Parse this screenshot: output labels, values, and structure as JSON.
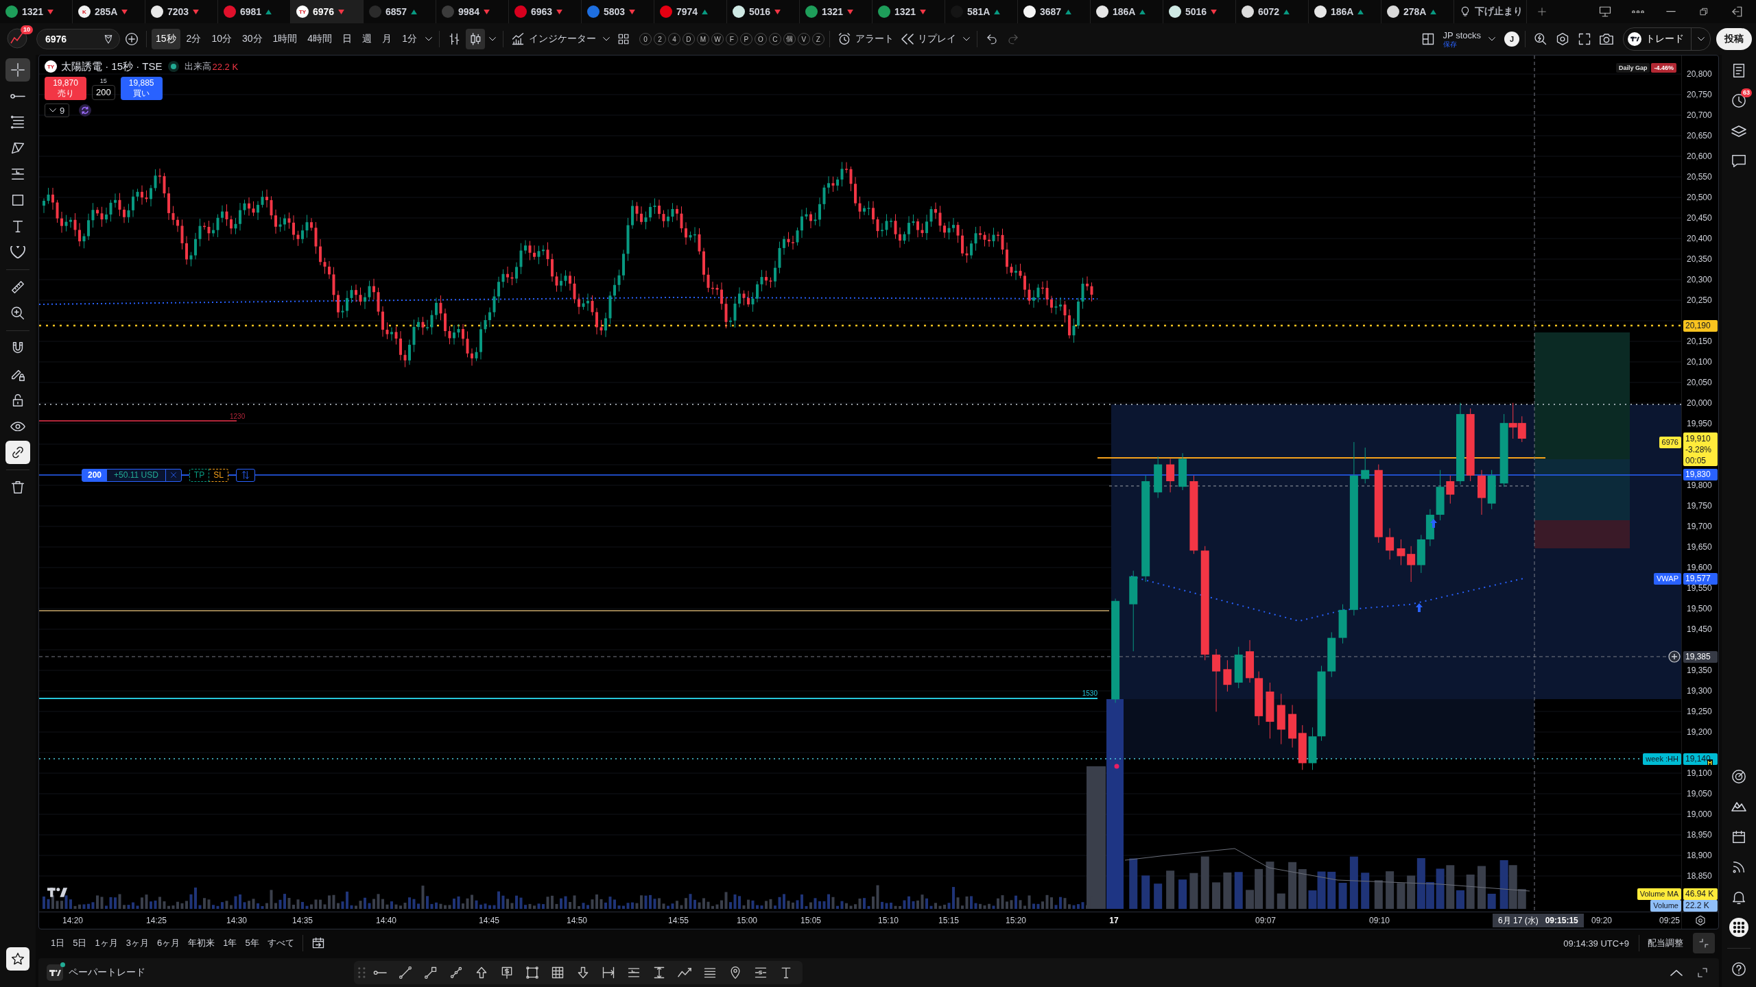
{
  "tabs": [
    {
      "kind": "symbol",
      "symbol": "1321",
      "rising": false,
      "color": "#1e9e5a",
      "selected": false
    },
    {
      "kind": "symbol",
      "symbol": "285A",
      "rising": false,
      "color": "#f2f2f2",
      "logo_text": "K",
      "selected": false
    },
    {
      "kind": "symbol",
      "symbol": "7203",
      "rising": false,
      "color": "#e8e8e8",
      "selected": false
    },
    {
      "kind": "symbol",
      "symbol": "6981",
      "rising": true,
      "color": "#e0102b",
      "selected": false
    },
    {
      "kind": "symbol",
      "symbol": "6976",
      "rising": false,
      "color": "#ffffff",
      "logo_text": "TY",
      "selected": true
    },
    {
      "kind": "symbol",
      "symbol": "6857",
      "rising": true,
      "color": "#2b2b2b",
      "selected": false
    },
    {
      "kind": "symbol",
      "symbol": "9984",
      "rising": false,
      "color": "#3c3c3c",
      "selected": false
    },
    {
      "kind": "symbol",
      "symbol": "6963",
      "rising": false,
      "color": "#d7001e",
      "selected": false
    },
    {
      "kind": "symbol",
      "symbol": "5803",
      "rising": false,
      "color": "#1e6fe0",
      "selected": false
    },
    {
      "kind": "symbol",
      "symbol": "7974",
      "rising": true,
      "color": "#e60012",
      "selected": false
    },
    {
      "kind": "symbol",
      "symbol": "5016",
      "rising": false,
      "color": "#cfe9e4",
      "selected": false
    },
    {
      "kind": "symbol",
      "symbol": "1321",
      "rising": false,
      "color": "#1e9e5a",
      "selected": false
    },
    {
      "kind": "symbol",
      "symbol": "1321",
      "rising": false,
      "color": "#1e9e5a",
      "selected": false
    },
    {
      "kind": "symbol",
      "symbol": "581A",
      "rising": true,
      "color": "#151515",
      "selected": false
    },
    {
      "kind": "symbol",
      "symbol": "3687",
      "rising": true,
      "color": "#f5f5f5",
      "selected": false
    },
    {
      "kind": "symbol",
      "symbol": "186A",
      "rising": true,
      "color": "#e6e6e6",
      "selected": false
    },
    {
      "kind": "symbol",
      "symbol": "5016",
      "rising": false,
      "color": "#cfe9e4",
      "selected": false
    },
    {
      "kind": "symbol",
      "symbol": "6072",
      "rising": true,
      "color": "#dcdcdc",
      "selected": false
    },
    {
      "kind": "symbol",
      "symbol": "186A",
      "rising": true,
      "color": "#e6e6e6",
      "selected": false
    },
    {
      "kind": "symbol",
      "symbol": "278A",
      "rising": true,
      "color": "#d9d9d9",
      "selected": false
    },
    {
      "kind": "note",
      "symbol": "下げ止まり",
      "selected": false
    }
  ],
  "toolbar": {
    "notifications": "10",
    "symbol_search": {
      "value": "6976"
    },
    "intervals": [
      {
        "label": "15秒",
        "selected": true
      },
      {
        "label": "2分",
        "selected": false
      },
      {
        "label": "10分",
        "selected": false
      },
      {
        "label": "30分",
        "selected": false
      },
      {
        "label": "1時間",
        "selected": false
      },
      {
        "label": "4時間",
        "selected": false
      },
      {
        "label": "日",
        "selected": false
      },
      {
        "label": "週",
        "selected": false
      },
      {
        "label": "月",
        "selected": false
      },
      {
        "label": "1分",
        "selected": false
      }
    ],
    "chart_types": [
      {
        "kind": "bars",
        "selected": false
      },
      {
        "kind": "candles",
        "selected": true
      }
    ],
    "indicators": "インジケーター",
    "shortcuts": [
      "0",
      "2",
      "4",
      "D",
      "M",
      "W",
      "F",
      "P",
      "O",
      "C",
      "個",
      "V",
      "Z"
    ],
    "alert": "アラート",
    "replay": "リプレイ",
    "history": [
      {
        "kind": "undo",
        "disabled": false
      },
      {
        "kind": "redo",
        "disabled": true
      }
    ],
    "layout": {
      "name": "JP stocks",
      "status": "保存"
    },
    "user_initial": "J",
    "trade": "トレード",
    "publish": "投稿"
  },
  "left_toolbar": {
    "groups": [
      {
        "items": [
          {
            "kind": "crosshair",
            "selected": true
          },
          {
            "kind": "line",
            "selected": false
          },
          {
            "kind": "fib",
            "selected": false
          },
          {
            "kind": "pattern",
            "selected": false
          },
          {
            "kind": "gann",
            "selected": false
          },
          {
            "kind": "rectangle",
            "selected": false
          },
          {
            "kind": "text",
            "selected": false
          },
          {
            "kind": "heart",
            "selected": false
          }
        ]
      },
      {
        "items": [
          {
            "kind": "ruler",
            "selected": false
          },
          {
            "kind": "zoom",
            "selected": false
          }
        ]
      },
      {
        "items": [
          {
            "kind": "magnet",
            "on": false
          },
          {
            "kind": "pencil_lock",
            "on": false
          },
          {
            "kind": "lock",
            "on": false
          },
          {
            "kind": "eye",
            "on": false
          },
          {
            "kind": "link",
            "on": true
          }
        ]
      },
      {
        "items": [
          {
            "kind": "trash"
          }
        ]
      }
    ]
  },
  "right_sidebar": {
    "alerts_badge": "63"
  },
  "chart": {
    "legend": {
      "logo_text": "TY",
      "title": "太陽誘電 · 15秒 · TSE",
      "market_open": true,
      "volume_label": "出来高",
      "volume_value": "22.2 K"
    },
    "trade_panel": {
      "sell_price": "19,870",
      "sell_label": "売り",
      "step": "15",
      "quantity": "200",
      "buy_price": "19,885",
      "buy_label": "買い"
    },
    "indicator_count": "9",
    "daily_gap": {
      "label": "Daily Gap",
      "value": "-4.46%"
    },
    "line_labels": [
      {
        "text": "1230",
        "color": "#b2263a"
      },
      {
        "text": "1530",
        "color": "#26c6da"
      }
    ],
    "order": {
      "quantity": "200",
      "pnl": "+50.11 USD",
      "take_profit": "TP",
      "stop_loss": "SL"
    },
    "price_axis": {
      "ticks": [
        "20,800",
        "20,750",
        "20,700",
        "20,650",
        "20,600",
        "20,550",
        "20,500",
        "20,450",
        "20,400",
        "20,350",
        "20,300",
        "20,250",
        "20,150",
        "20,100",
        "20,050",
        "20,000",
        "19,950",
        "19,800",
        "19,750",
        "19,700",
        "19,650",
        "19,600",
        "19,550",
        "19,500",
        "19,450",
        "19,350",
        "19,300",
        "19,250",
        "19,200",
        "19,100",
        "19,050",
        "19,000",
        "18,950",
        "18,900",
        "18,850"
      ],
      "markers": [
        {
          "kind": "price",
          "label": "20,190",
          "color": "#f9c31f"
        },
        {
          "kind": "countdown",
          "tag": "6976",
          "lines": [
            "19,910",
            "-3.28%",
            "00:05"
          ],
          "color": "#ffeb3b"
        },
        {
          "kind": "price",
          "label": "19,830",
          "color": "#2962ff"
        },
        {
          "kind": "tagged",
          "tag": "VWAP",
          "label": "19,577",
          "color": "#2962ff"
        },
        {
          "kind": "crosshair",
          "label": "19,385",
          "color": "#363a45"
        },
        {
          "kind": "tagged",
          "tag": "week :HH",
          "label": "19,140",
          "color": "#00bcd4"
        },
        {
          "kind": "tagged",
          "tag": "Volume MA",
          "label": "46.94 K",
          "color": "#ffeb3b"
        },
        {
          "kind": "tagged",
          "tag": "Volume",
          "label": "22.2 K",
          "color": "#90bff9"
        }
      ]
    },
    "week_flag": "H",
    "time_axis": {
      "ticks": [
        {
          "label": "14:20",
          "kind": "time"
        },
        {
          "label": "14:25",
          "kind": "time"
        },
        {
          "label": "14:30",
          "kind": "time"
        },
        {
          "label": "14:35",
          "kind": "time"
        },
        {
          "label": "14:40",
          "kind": "time"
        },
        {
          "label": "14:45",
          "kind": "time"
        },
        {
          "label": "14:50",
          "kind": "time"
        },
        {
          "label": "14:55",
          "kind": "time"
        },
        {
          "label": "15:00",
          "kind": "time"
        },
        {
          "label": "15:05",
          "kind": "time"
        },
        {
          "label": "15:10",
          "kind": "time"
        },
        {
          "label": "15:15",
          "kind": "time"
        },
        {
          "label": "15:20",
          "kind": "time"
        },
        {
          "label": "17",
          "kind": "day"
        },
        {
          "label": "09:07",
          "kind": "time"
        },
        {
          "label": "09:10",
          "kind": "time"
        },
        {
          "label": "09:20",
          "kind": "time"
        },
        {
          "label": "09:25",
          "kind": "time"
        }
      ],
      "crosshair": {
        "date": "6月 17 (水)",
        "time": "09:15:15"
      }
    }
  },
  "range_bar": {
    "ranges": [
      "1日",
      "5日",
      "1ヶ月",
      "3ヶ月",
      "6ヶ月",
      "年初来",
      "1年",
      "5年",
      "すべて"
    ],
    "clock": "09:14:39 UTC+9",
    "adjustment": "配当調整"
  },
  "bottom_panel": {
    "title": "ペーパートレード",
    "connected": true
  }
}
